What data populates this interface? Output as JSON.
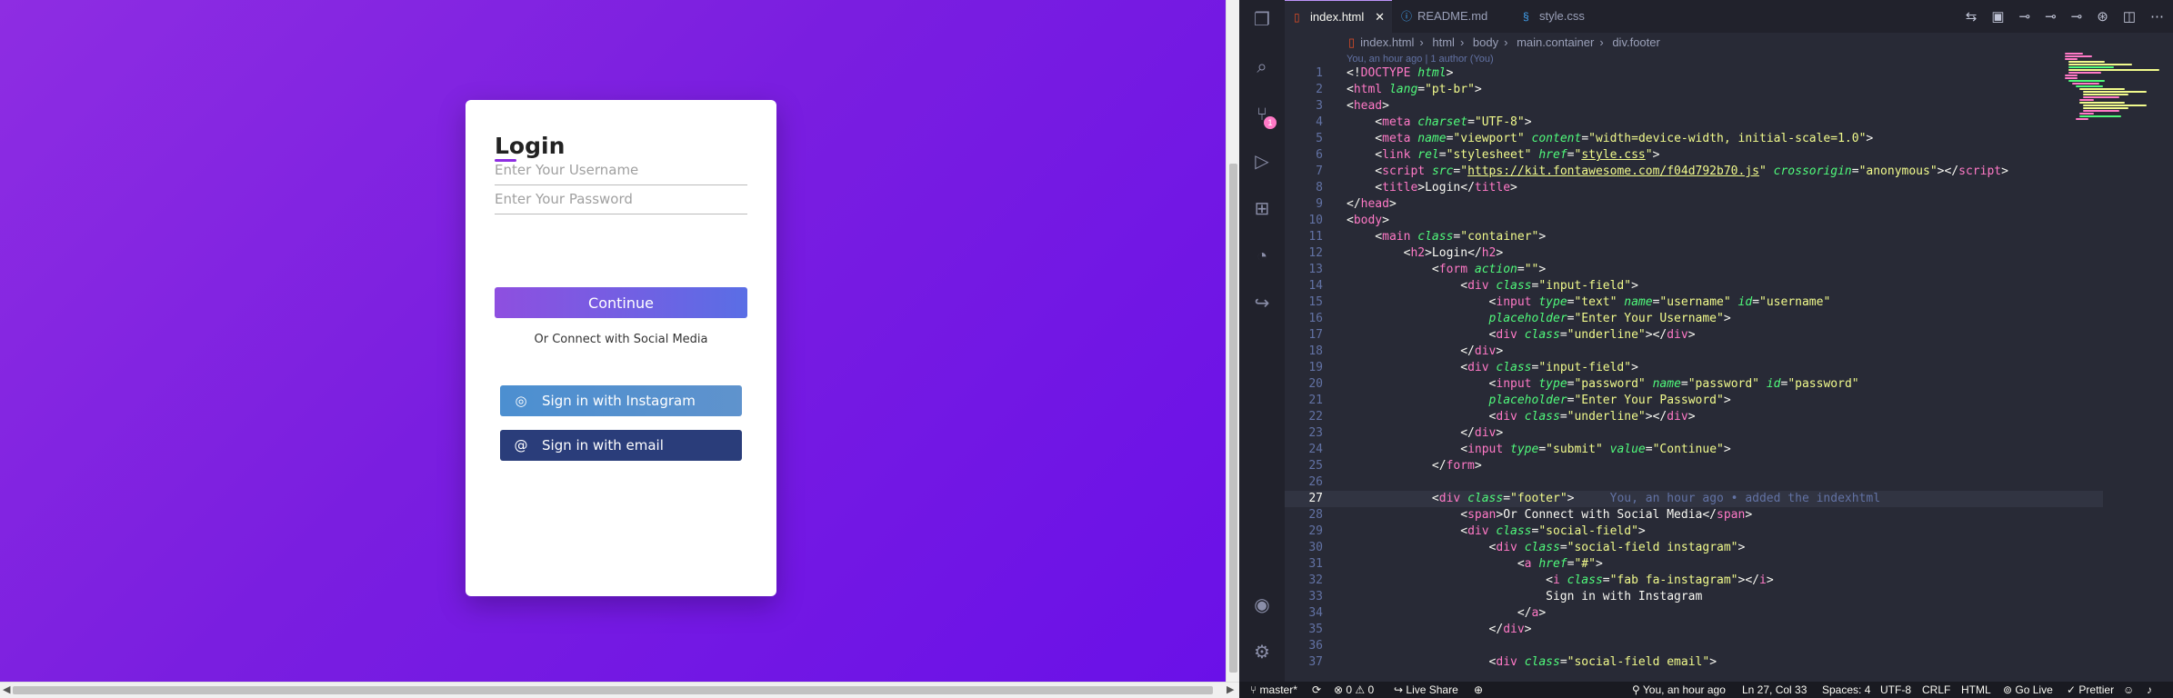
{
  "login": {
    "title": "Login",
    "username_placeholder": "Enter Your Username",
    "password_placeholder": "Enter Your Password",
    "continue_label": "Continue",
    "footer_text": "Or Connect with Social Media",
    "instagram_label": "Sign in with Instagram",
    "email_label": "Sign in with email"
  },
  "editor": {
    "tabs": [
      {
        "label": "index.html",
        "active": true
      },
      {
        "label": "README.md",
        "active": false
      },
      {
        "label": "style.css",
        "active": false
      }
    ],
    "breadcrumb": [
      "index.html",
      "html",
      "body",
      "main.container",
      "div.footer"
    ],
    "blame_header": "You, an hour ago | 1 author (You)",
    "inline_blame": "You, an hour ago • added the indexhtml",
    "scm_badge": "1"
  },
  "status": {
    "branch": "master*",
    "errors": "0",
    "warnings": "0",
    "live_share": "Live Share",
    "blame": "You, an hour ago",
    "position": "Ln 27, Col 33",
    "spaces": "Spaces: 4",
    "encoding": "UTF-8",
    "eol": "CRLF",
    "language": "HTML",
    "go_live": "Go Live",
    "prettier": "Prettier"
  }
}
